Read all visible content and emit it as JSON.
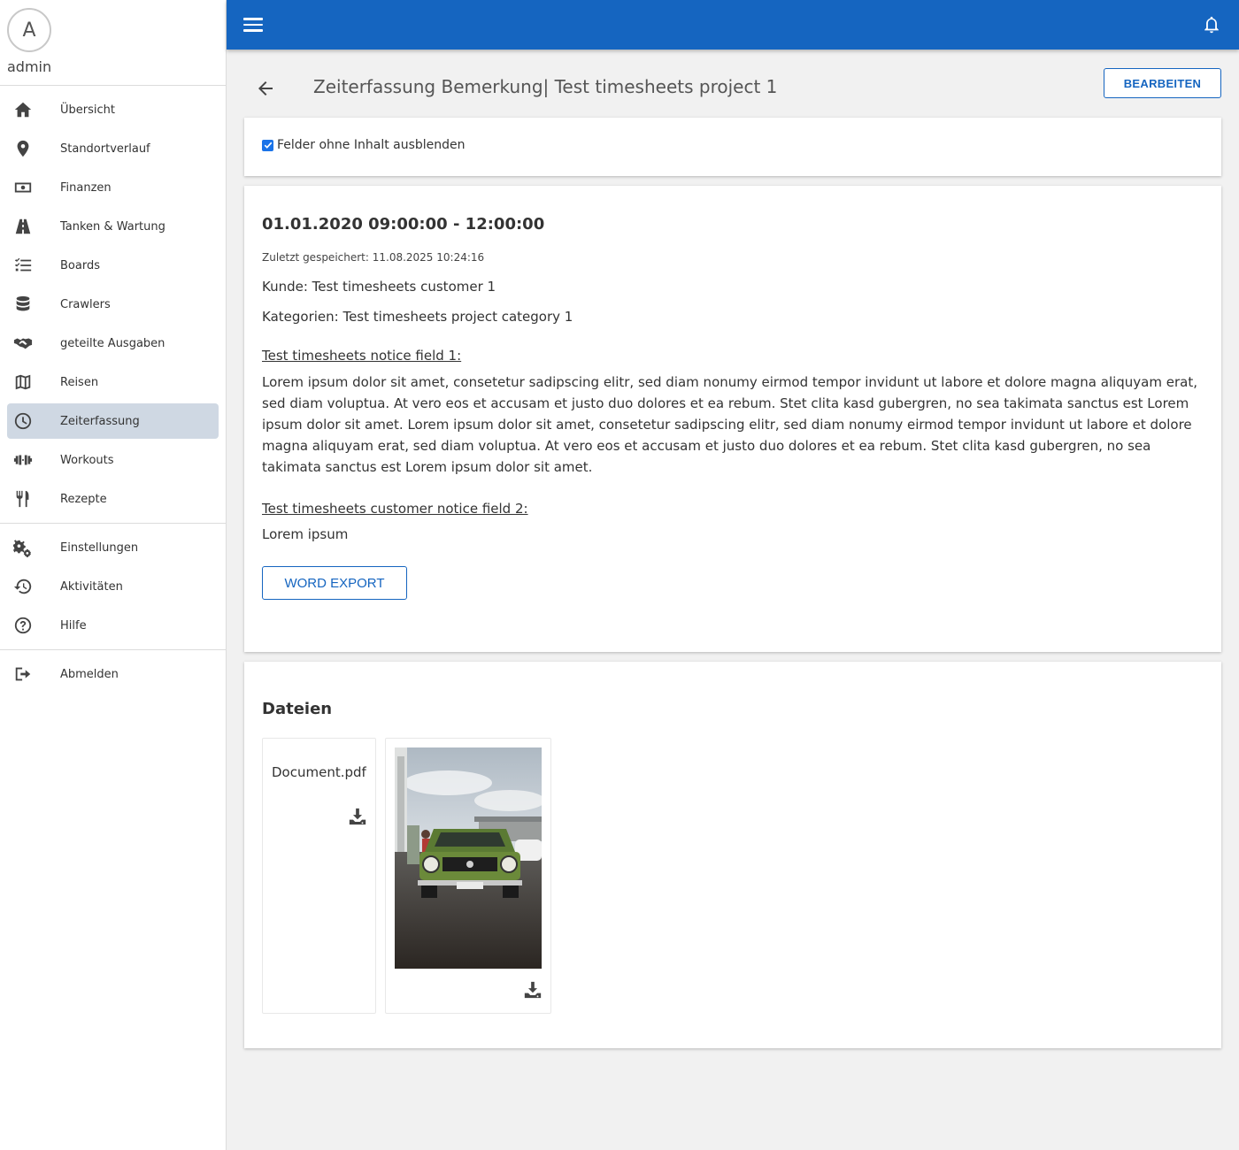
{
  "user": {
    "avatar_letter": "A",
    "name": "admin"
  },
  "nav": {
    "main": [
      {
        "label": "Übersicht",
        "icon": "home-icon"
      },
      {
        "label": "Standortverlauf",
        "icon": "location-pin-icon"
      },
      {
        "label": "Finanzen",
        "icon": "money-icon"
      },
      {
        "label": "Tanken & Wartung",
        "icon": "road-icon"
      },
      {
        "label": "Boards",
        "icon": "checklist-icon"
      },
      {
        "label": "Crawlers",
        "icon": "database-icon"
      },
      {
        "label": "geteilte Ausgaben",
        "icon": "handshake-icon"
      },
      {
        "label": "Reisen",
        "icon": "map-icon"
      },
      {
        "label": "Zeiterfassung",
        "icon": "clock-icon",
        "active": true
      },
      {
        "label": "Workouts",
        "icon": "dumbbell-icon"
      },
      {
        "label": "Rezepte",
        "icon": "utensils-icon"
      }
    ],
    "secondary": [
      {
        "label": "Einstellungen",
        "icon": "gears-icon"
      },
      {
        "label": "Aktivitäten",
        "icon": "history-icon"
      },
      {
        "label": "Hilfe",
        "icon": "help-icon"
      }
    ],
    "logout": {
      "label": "Abmelden",
      "icon": "logout-icon"
    }
  },
  "colors": {
    "primary": "#1565c0",
    "active_nav": "#cfd8e3",
    "background": "#f1f1f1"
  },
  "page": {
    "title": "Zeiterfassung Bemerkung| Test timesheets project 1",
    "edit_label": "BEARBEITEN"
  },
  "filter": {
    "hide_empty_label": "Felder ohne Inhalt ausblenden",
    "hide_empty_checked": true
  },
  "entry": {
    "date_range": "01.01.2020 09:00:00 - 12:00:00",
    "last_saved": "Zuletzt gespeichert: 11.08.2025 10:24:16",
    "customer": "Kunde: Test timesheets customer 1",
    "categories": "Kategorien: Test timesheets project category 1",
    "field1_label": "Test timesheets notice field 1:",
    "field1_text": "Lorem ipsum dolor sit amet, consetetur sadipscing elitr, sed diam nonumy eirmod tempor invidunt ut labore et dolore magna aliquyam erat, sed diam voluptua. At vero eos et accusam et justo duo dolores et ea rebum. Stet clita kasd gubergren, no sea takimata sanctus est Lorem ipsum dolor sit amet. Lorem ipsum dolor sit amet, consetetur sadipscing elitr, sed diam nonumy eirmod tempor invidunt ut labore et dolore magna aliquyam erat, sed diam voluptua. At vero eos et accusam et justo duo dolores et ea rebum. Stet clita kasd gubergren, no sea takimata sanctus est Lorem ipsum dolor sit amet.",
    "field2_label": "Test timesheets customer notice field 2:",
    "field2_text": "Lorem ipsum",
    "word_export_label": "WORD EXPORT"
  },
  "files": {
    "title": "Dateien",
    "items": [
      {
        "name": "Document.pdf",
        "type": "pdf"
      },
      {
        "type": "image"
      }
    ]
  }
}
